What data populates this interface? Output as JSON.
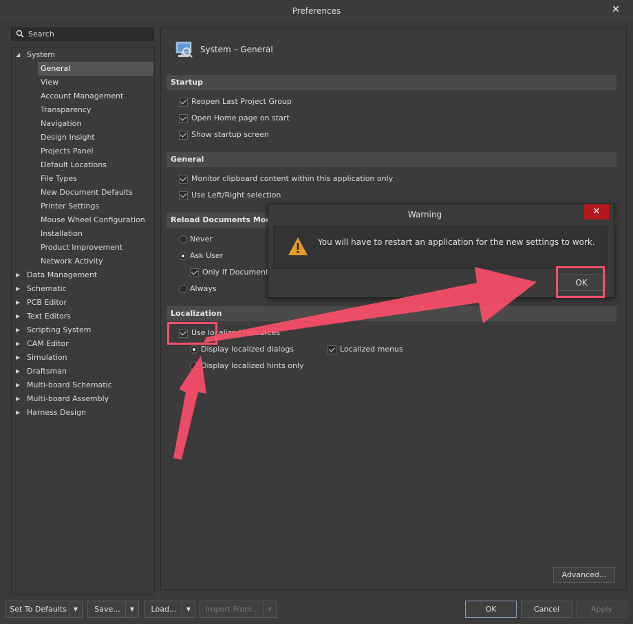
{
  "window": {
    "title": "Preferences"
  },
  "search": {
    "placeholder": "Search"
  },
  "tree": {
    "root_expanded": "System",
    "system_children": [
      "General",
      "View",
      "Account Management",
      "Transparency",
      "Navigation",
      "Design Insight",
      "Projects Panel",
      "Default Locations",
      "File Types",
      "New Document Defaults",
      "Printer Settings",
      "Mouse Wheel Configuration",
      "Installation",
      "Product Improvement",
      "Network Activity"
    ],
    "selected": "General",
    "collapsed_nodes": [
      "Data Management",
      "Schematic",
      "PCB Editor",
      "Text Editors",
      "Scripting System",
      "CAM Editor",
      "Simulation",
      "Draftsman",
      "Multi-board Schematic",
      "Multi-board Assembly",
      "Harness Design"
    ]
  },
  "panel": {
    "title": "System – General",
    "startup": {
      "header": "Startup",
      "items": [
        {
          "label": "Reopen Last Project Group",
          "checked": true
        },
        {
          "label": "Open Home page on start",
          "checked": true
        },
        {
          "label": "Show startup screen",
          "checked": true
        }
      ]
    },
    "general": {
      "header": "General",
      "items": [
        {
          "label": "Monitor clipboard content within this application only",
          "checked": true
        },
        {
          "label": "Use Left/Right selection",
          "checked": true
        }
      ]
    },
    "reload": {
      "header": "Reload Documents Modified",
      "never": "Never",
      "ask_user": "Ask User",
      "only_if": "Only If Document I",
      "always": "Always",
      "selected": "Ask User"
    },
    "localization": {
      "header": "Localization",
      "use_localized": "Use localized resources",
      "display_dialogs": "Display localized dialogs",
      "display_hints": "Display localized hints only",
      "localized_menus": "Localized menus"
    },
    "advanced": "Advanced..."
  },
  "footer": {
    "set_defaults": "Set To Defaults",
    "save": "Save...",
    "load": "Load...",
    "import_from": "Import From...",
    "ok": "OK",
    "cancel": "Cancel",
    "apply": "Apply"
  },
  "warning": {
    "title": "Warning",
    "message": "You will have to restart an application for the new settings to work.",
    "ok": "OK",
    "close": "✕"
  },
  "colors": {
    "annotation": "#ff4f6a",
    "close_red": "#b4191d",
    "warning_orange": "#e89b22"
  }
}
